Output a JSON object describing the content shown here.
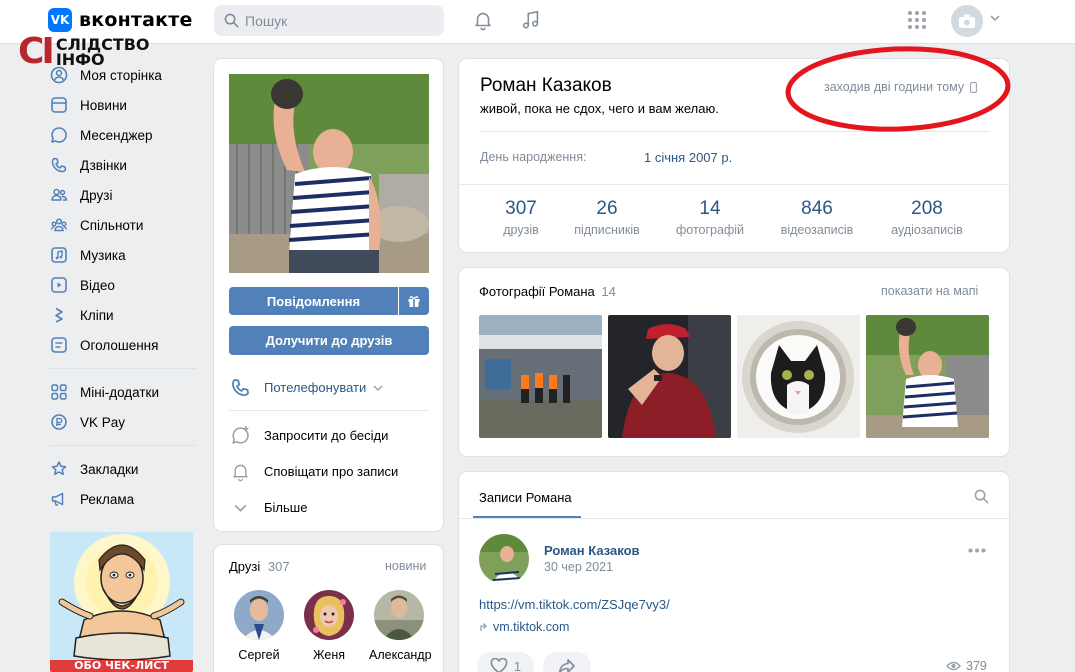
{
  "header": {
    "logo_mark": "VK",
    "logo_text": "вконтакте",
    "search_placeholder": "Пошук"
  },
  "watermark": {
    "mark": "CI",
    "line1": "СЛІДСТВО",
    "line2": "ІНФО"
  },
  "sidebar": {
    "items": [
      {
        "label": "Моя сторінка",
        "icon": "user-circle-icon"
      },
      {
        "label": "Новини",
        "icon": "news-icon"
      },
      {
        "label": "Месенджер",
        "icon": "message-icon"
      },
      {
        "label": "Дзвінки",
        "icon": "phone-icon"
      },
      {
        "label": "Друзі",
        "icon": "friends-icon"
      },
      {
        "label": "Спільноти",
        "icon": "communities-icon"
      },
      {
        "label": "Музика",
        "icon": "music-icon"
      },
      {
        "label": "Відео",
        "icon": "video-icon"
      },
      {
        "label": "Кліпи",
        "icon": "clips-icon"
      },
      {
        "label": "Оголошення",
        "icon": "classifieds-icon"
      }
    ],
    "items2": [
      {
        "label": "Міні-додатки",
        "icon": "apps-icon"
      },
      {
        "label": "VK Pay",
        "icon": "vkpay-icon"
      }
    ],
    "items3": [
      {
        "label": "Закладки",
        "icon": "bookmark-icon"
      },
      {
        "label": "Реклама",
        "icon": "megaphone-icon"
      }
    ],
    "ad_banner_text": "ОБО ЧЕК-ЛИСТ"
  },
  "profile_actions": {
    "message_button": "Повідомлення",
    "add_friend_button": "Долучити до друзів",
    "call_label": "Потелефонувати",
    "invite_label": "Запросити до бесіди",
    "notify_label": "Сповіщати про записи",
    "more_label": "Більше"
  },
  "friends_block": {
    "title": "Друзі",
    "count": "307",
    "news_link": "новини",
    "friends": [
      {
        "name": "Сергей"
      },
      {
        "name": "Женя"
      },
      {
        "name": "Александр"
      }
    ]
  },
  "profile": {
    "name": "Роман Казаков",
    "status": "живой, пока не сдох, чего и вам желаю.",
    "last_seen": "заходив дві години тому",
    "birthday_label": "День народження:",
    "birthday_value": "1 січня 2007 р.",
    "stats": [
      {
        "num": "307",
        "label": "друзів"
      },
      {
        "num": "26",
        "label": "підписників"
      },
      {
        "num": "14",
        "label": "фотографій"
      },
      {
        "num": "846",
        "label": "відеозаписів"
      },
      {
        "num": "208",
        "label": "аудіозаписів"
      }
    ]
  },
  "photos_block": {
    "title": "Фотографії Романа",
    "count": "14",
    "map_link": "показати на мапі"
  },
  "posts_block": {
    "tab_label": "Записи Романа",
    "post": {
      "author": "Роман Казаков",
      "date": "30 чер 2021",
      "link": "https://vm.tiktok.com/ZSJqe7vy3/",
      "domain": "vm.tiktok.com",
      "likes": "1",
      "views": "379"
    }
  },
  "colors": {
    "accent": "#5181b8",
    "link": "#2a5885",
    "annotation_ring": "#e4161d"
  }
}
